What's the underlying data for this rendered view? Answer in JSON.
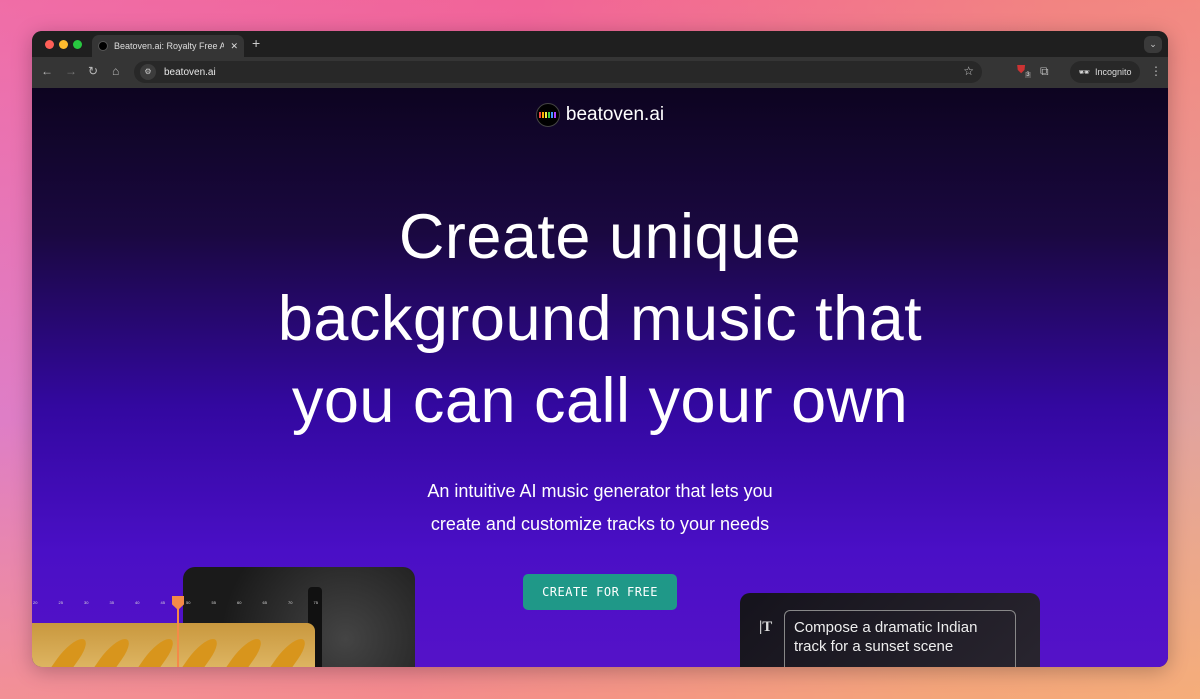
{
  "browser": {
    "tab_title": "Beatoven.ai: Royalty Free AI M",
    "url": "beatoven.ai",
    "incognito_label": "Incognito",
    "extension_badge": "3"
  },
  "page": {
    "brand": "beatoven.ai",
    "headline_lines": [
      "Create unique",
      "background music that",
      "you can call your own"
    ],
    "subtitle_lines": [
      "An intuitive AI music generator that lets you",
      "create and customize tracks to your needs"
    ],
    "cta_label": "CREATE FOR FREE",
    "ruler_ticks": [
      "20",
      "25",
      "30",
      "35",
      "40",
      "45",
      "50",
      "55",
      "60",
      "65",
      "70",
      "75"
    ],
    "prompt_text": "Compose a dramatic Indian track for a sunset scene",
    "prompt_icon": "text-cursor-T"
  },
  "colors": {
    "cta": "#1f9888",
    "playhead": "#f48a48",
    "track": "#d8a848"
  }
}
